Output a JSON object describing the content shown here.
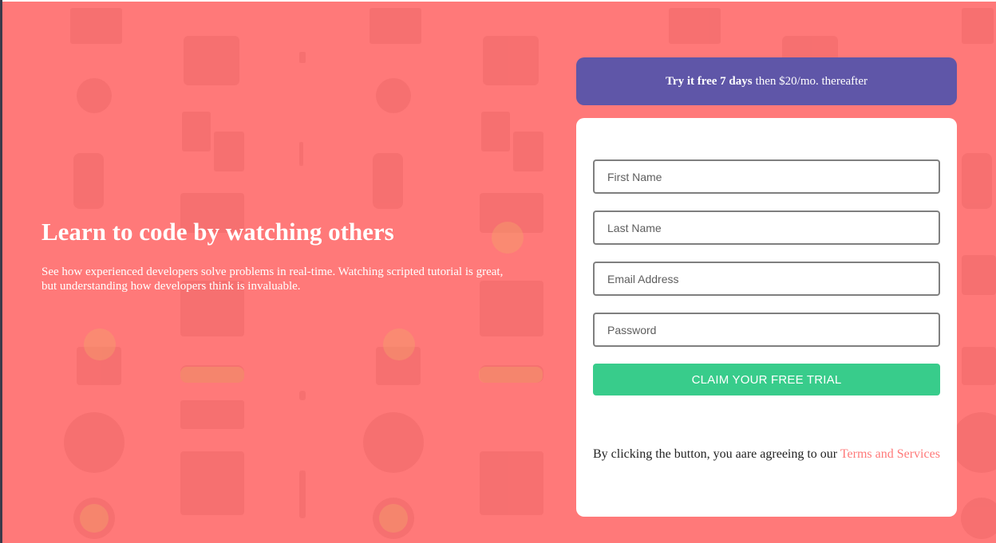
{
  "hero": {
    "title": "Learn to code by watching others",
    "description": "See how experienced developers solve problems in real-time. Watching scripted tutorial is great, but understanding how developers think is invaluable."
  },
  "banner": {
    "bold_text": "Try it free 7 days",
    "rest_text": "then $20/mo. thereafter"
  },
  "form": {
    "first_name_placeholder": "First Name",
    "last_name_placeholder": "Last Name",
    "email_placeholder": "Email Address",
    "password_placeholder": "Password",
    "submit_label": "CLAIM YOUR FREE TRIAL",
    "terms_text": "By clicking the button, you aare agreeing to our",
    "terms_link": "Terms and Services"
  },
  "colors": {
    "background": "#ff7979",
    "banner": "#5f56a8",
    "accent_green": "#38cc8b",
    "link": "#ff7979"
  }
}
